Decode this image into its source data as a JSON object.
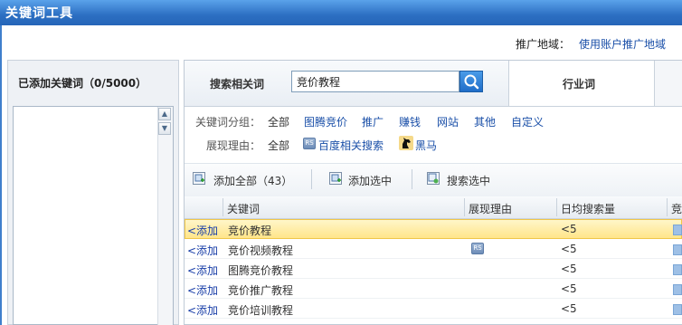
{
  "window": {
    "title": "关键词工具"
  },
  "region": {
    "label": "推广地域：",
    "link": "使用账户推广地域"
  },
  "left_panel": {
    "title": "已添加关键词（0/5000）"
  },
  "tabs": {
    "search_tab": "搜索相关词",
    "industry_tab": "行业词"
  },
  "search": {
    "value": "竞价教程"
  },
  "filters": {
    "group_label": "关键词分组：",
    "groups": [
      "全部",
      "图腾竞价",
      "推广",
      "赚钱",
      "网站",
      "其他",
      "自定义"
    ],
    "reason_label": "展现理由：",
    "reasons": [
      "全部",
      "百度相关搜索",
      "黑马"
    ]
  },
  "toolbar": {
    "add_all": "添加全部（43）",
    "add_selected": "添加选中",
    "search_selected": "搜索选中"
  },
  "table": {
    "headers": [
      "关键词",
      "展现理由",
      "日均搜索量",
      "竞"
    ],
    "add_label": "<添加",
    "rows": [
      {
        "keyword": "竞价教程",
        "reason_icon": "",
        "volume": "<5",
        "selected": true
      },
      {
        "keyword": "竞价视频教程",
        "reason_icon": "RS",
        "volume": "<5",
        "selected": false
      },
      {
        "keyword": "图腾竞价教程",
        "reason_icon": "",
        "volume": "<5",
        "selected": false
      },
      {
        "keyword": "竞价推广教程",
        "reason_icon": "",
        "volume": "<5",
        "selected": false
      },
      {
        "keyword": "竞价培训教程",
        "reason_icon": "",
        "volume": "<5",
        "selected": false
      }
    ]
  },
  "icons": {
    "rs_badge": "RS",
    "search_icon": "magnifier-icon",
    "heima_icon": "black-horse-icon"
  },
  "colors": {
    "titlebar": "#2c6fc2",
    "link": "#1a4fa8",
    "selected_row": "#ffe58a"
  }
}
